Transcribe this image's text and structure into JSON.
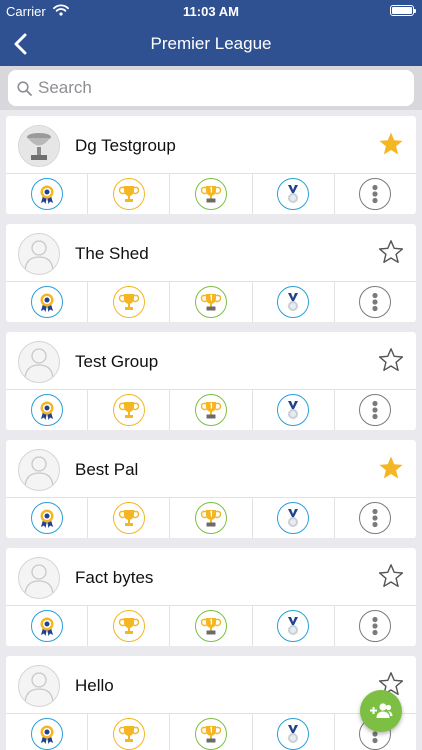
{
  "status_bar": {
    "carrier": "Carrier",
    "time": "11:03 AM"
  },
  "nav": {
    "title": "Premier League"
  },
  "search": {
    "placeholder": "Search"
  },
  "colors": {
    "nav_bg": "#2f5192",
    "star_active": "#f5b623",
    "fab": "#7cbf43",
    "badge_blue": "#2a9fd8",
    "trophy_gold": "#f5b623",
    "medal_navy": "#24418c"
  },
  "groups": [
    {
      "name": "Dg Testgroup",
      "favorite": true,
      "avatar": "photo"
    },
    {
      "name": "The Shed",
      "favorite": false,
      "avatar": "placeholder"
    },
    {
      "name": "Test Group",
      "favorite": false,
      "avatar": "placeholder"
    },
    {
      "name": "Best Pal",
      "favorite": true,
      "avatar": "placeholder"
    },
    {
      "name": "Fact bytes",
      "favorite": false,
      "avatar": "placeholder"
    },
    {
      "name": "Hello",
      "favorite": false,
      "avatar": "placeholder"
    }
  ],
  "actions": [
    {
      "icon": "rosette-badge-icon"
    },
    {
      "icon": "trophy-icon"
    },
    {
      "icon": "first-place-trophy-icon"
    },
    {
      "icon": "medal-icon"
    },
    {
      "icon": "more-icon"
    }
  ],
  "fab": {
    "icon": "add-group-icon"
  }
}
